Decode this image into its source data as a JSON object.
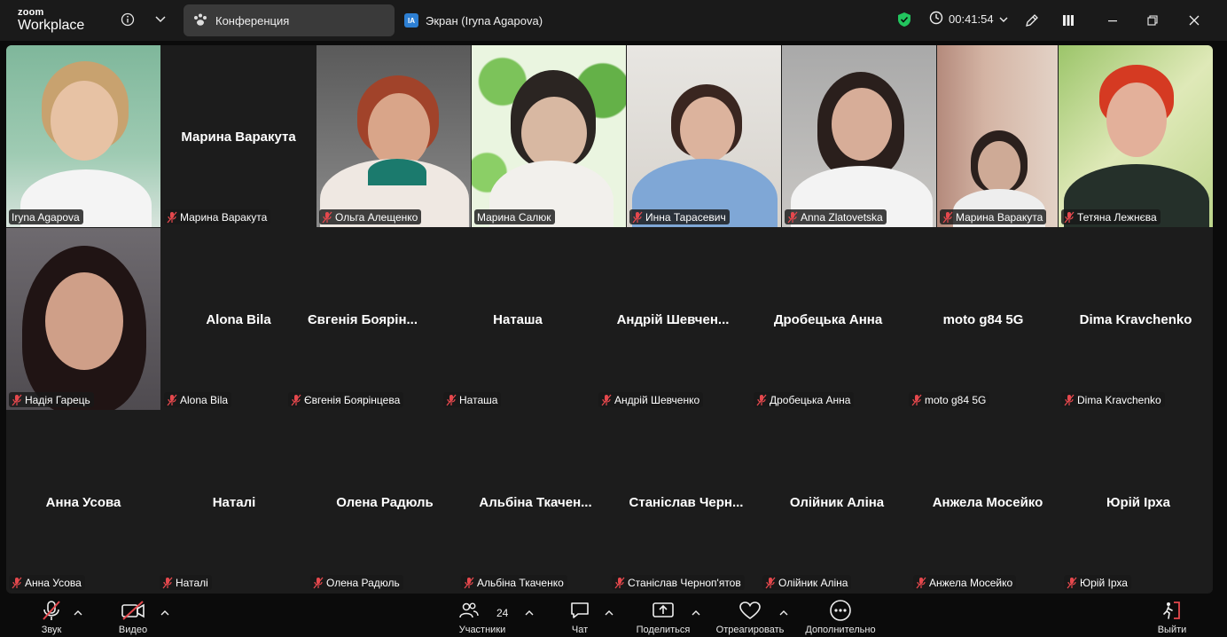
{
  "app": {
    "brand_top": "zoom",
    "brand_bottom": "Workplace"
  },
  "tabs": [
    {
      "label": "Конференция",
      "icon": "meeting-paw-icon",
      "active": true
    },
    {
      "label": "Экран (Iryna Agapova)",
      "badge": "IA",
      "active": false
    }
  ],
  "status": {
    "timer": "00:41:54",
    "security": "shield-check-icon"
  },
  "participants_count": "24",
  "participants": [
    {
      "name": "Iryna Agapova",
      "muted": false,
      "video": true
    },
    {
      "name": "Марина Варакута",
      "muted": true,
      "video": false
    },
    {
      "name": "Ольга Алещенко",
      "muted": true,
      "video": true
    },
    {
      "name": "Марина Салюк",
      "muted": false,
      "video": true,
      "speaking": true
    },
    {
      "name": "Инна Тарасевич",
      "muted": true,
      "video": true
    },
    {
      "name": "Anna Zlatovetska",
      "muted": true,
      "video": true
    },
    {
      "name": "Марина Варакута",
      "muted": true,
      "video": true
    },
    {
      "name": "Тетяна Лежнєва",
      "muted": true,
      "video": true
    },
    {
      "name": "Надія Гарець",
      "muted": true,
      "video": true
    },
    {
      "name": "Alona Bila",
      "muted": true,
      "video": false
    },
    {
      "name": "Євгенія Боярінцева",
      "display": "Євгенія Боярін...",
      "muted": true,
      "video": false
    },
    {
      "name": "Наташа",
      "muted": true,
      "video": false
    },
    {
      "name": "Андрій Шевченко",
      "display": "Андрій Шевчен...",
      "muted": true,
      "video": false
    },
    {
      "name": "Дробецька Анна",
      "muted": true,
      "video": false
    },
    {
      "name": "moto g84 5G",
      "muted": true,
      "video": false
    },
    {
      "name": "Dima Kravchenko",
      "muted": true,
      "video": false
    },
    {
      "name": "Анна Усова",
      "muted": true,
      "video": false
    },
    {
      "name": "Наталі",
      "muted": true,
      "video": false
    },
    {
      "name": "Олена Радюль",
      "muted": true,
      "video": false
    },
    {
      "name": "Альбіна Ткаченко",
      "display": "Альбіна Ткачен...",
      "muted": true,
      "video": false
    },
    {
      "name": "Станіслав Черноп'ятов",
      "display": "Станіслав Черн...",
      "muted": true,
      "video": false
    },
    {
      "name": "Олійник Аліна",
      "muted": true,
      "video": false
    },
    {
      "name": "Анжела Мосейко",
      "muted": true,
      "video": false
    },
    {
      "name": "Юрій Ірха",
      "muted": true,
      "video": false
    }
  ],
  "toolbar": {
    "audio": "Звук",
    "video": "Видео",
    "participants": "Участники",
    "chat": "Чат",
    "share": "Поделиться",
    "react": "Отреагировать",
    "more": "Дополнительно",
    "leave": "Выйти"
  },
  "colors": {
    "speaking": "#2bd96a",
    "muted_icon": "#e5484d",
    "leave": "#e5484d",
    "tab_active": "#3a3a3a"
  }
}
